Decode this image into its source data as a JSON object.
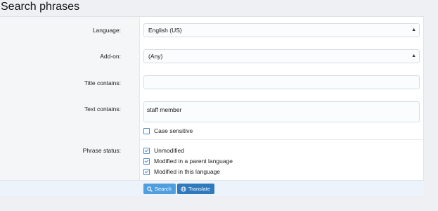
{
  "page": {
    "title": "Search phrases"
  },
  "form": {
    "language": {
      "label": "Language:",
      "value": "English (US)"
    },
    "addon": {
      "label": "Add-on:",
      "value": "(Any)"
    },
    "title_contains": {
      "label": "Title contains:",
      "value": ""
    },
    "text_contains": {
      "label": "Text contains:",
      "value": "staff member"
    },
    "case_sensitive": {
      "label": "Case sensitive",
      "checked": false
    },
    "phrase_status": {
      "label": "Phrase status:",
      "options": [
        {
          "label": "Unmodified",
          "checked": true
        },
        {
          "label": "Modified in a parent language",
          "checked": true
        },
        {
          "label": "Modified in this language",
          "checked": true
        }
      ]
    }
  },
  "buttons": {
    "search": {
      "label": "Search",
      "icon": "search-icon"
    },
    "translate": {
      "label": "Translate",
      "icon": "globe-icon"
    }
  },
  "colors": {
    "accent": "#4f9ee0",
    "accent_dark": "#2f79bd",
    "checkbox": "#4a8bd0"
  }
}
